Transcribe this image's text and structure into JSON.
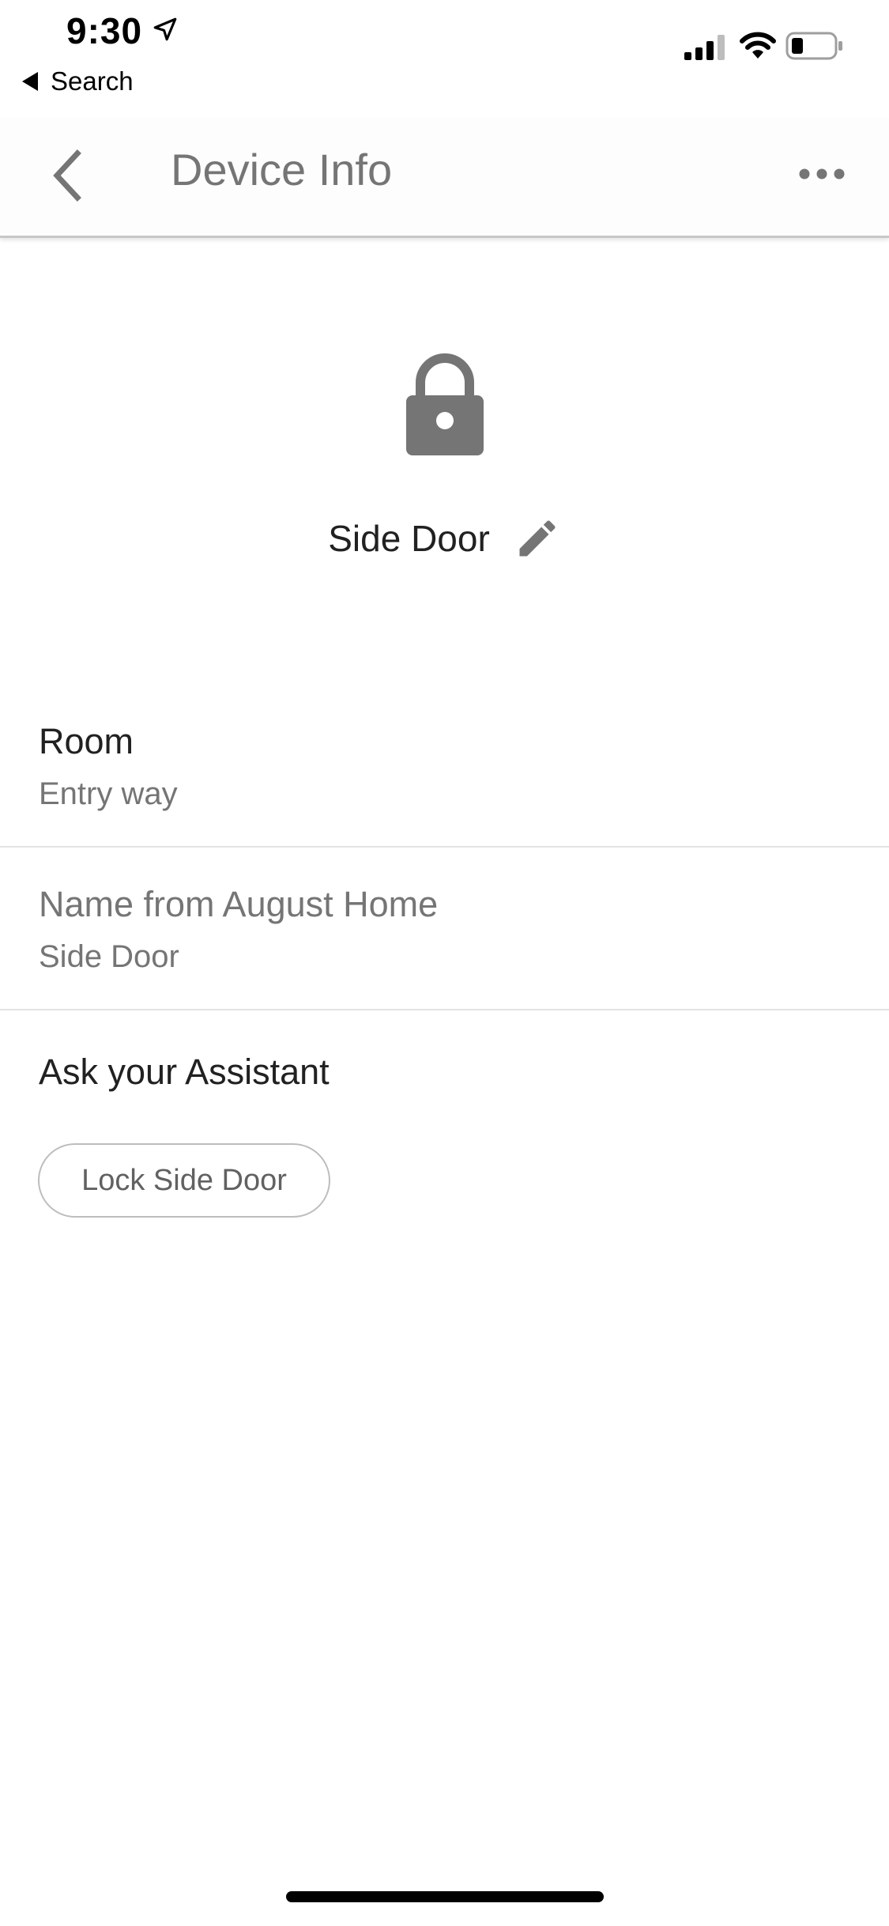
{
  "status_bar": {
    "time": "9:30",
    "back_to_app_label": "Search",
    "icons": [
      "location-arrow-icon",
      "cellular-signal-icon",
      "wifi-icon",
      "battery-icon"
    ]
  },
  "app_bar": {
    "title": "Device Info",
    "back_icon": "chevron-left-icon",
    "more_icon": "more-horizontal-icon"
  },
  "device": {
    "icon": "lock-icon",
    "name": "Side Door",
    "edit_icon": "pencil-icon"
  },
  "room": {
    "label": "Room",
    "value": "Entry way"
  },
  "august": {
    "label": "Name from August Home",
    "value": "Side Door"
  },
  "assistant": {
    "label": "Ask your Assistant",
    "chip": "Lock Side Door"
  },
  "colors": {
    "primary_text": "#212121",
    "secondary_text": "#757575",
    "icon_gray": "#757575",
    "divider": "#e3e3e3"
  }
}
